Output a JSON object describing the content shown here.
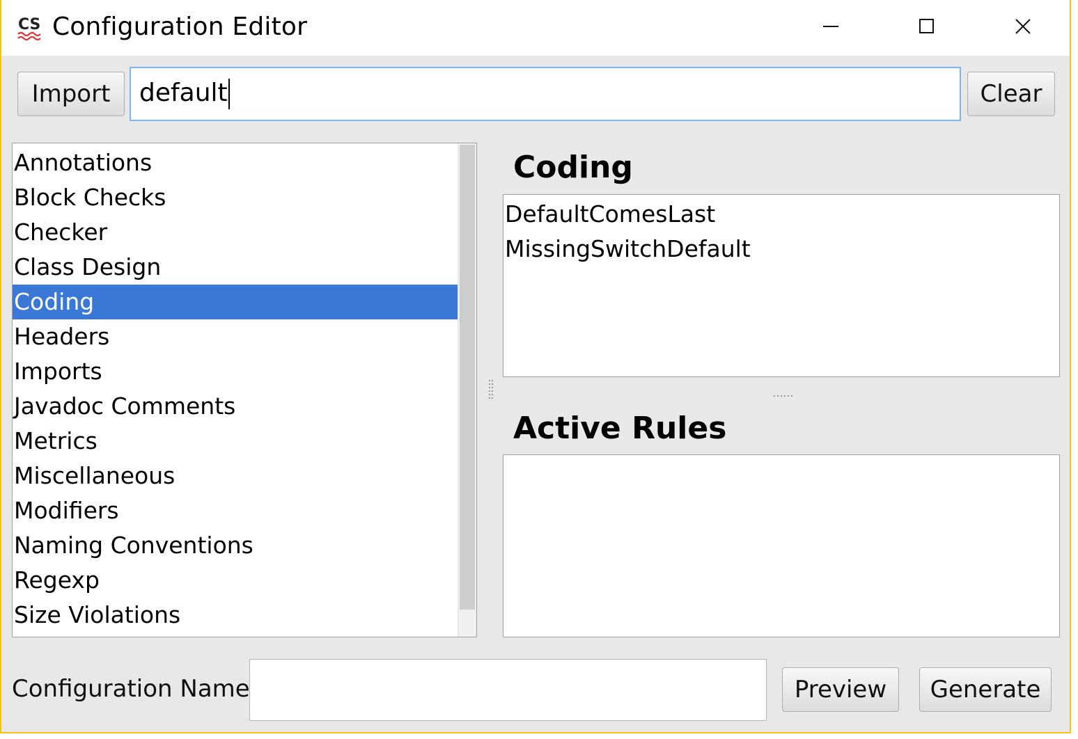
{
  "window": {
    "title": "Configuration Editor",
    "app_icon_text": "CS",
    "controls": [
      "minimize-icon",
      "maximize-icon",
      "close-icon"
    ],
    "border_color": "#f0c419"
  },
  "toolbar": {
    "import_label": "Import",
    "search_value": "default",
    "clear_label": "Clear"
  },
  "categories": {
    "items": [
      "Annotations",
      "Block Checks",
      "Checker",
      "Class Design",
      "Coding",
      "Headers",
      "Imports",
      "Javadoc Comments",
      "Metrics",
      "Miscellaneous",
      "Modifiers",
      "Naming Conventions",
      "Regexp",
      "Size Violations"
    ],
    "selected": "Coding",
    "selection_color": "#3a78d8"
  },
  "rules_panel": {
    "heading": "Coding",
    "items": [
      "DefaultComesLast",
      "MissingSwitchDefault"
    ]
  },
  "active_panel": {
    "heading": "Active Rules",
    "items": []
  },
  "footer": {
    "config_name_label": "Configuration Name:",
    "config_name_value": "",
    "preview_label": "Preview",
    "generate_label": "Generate"
  }
}
